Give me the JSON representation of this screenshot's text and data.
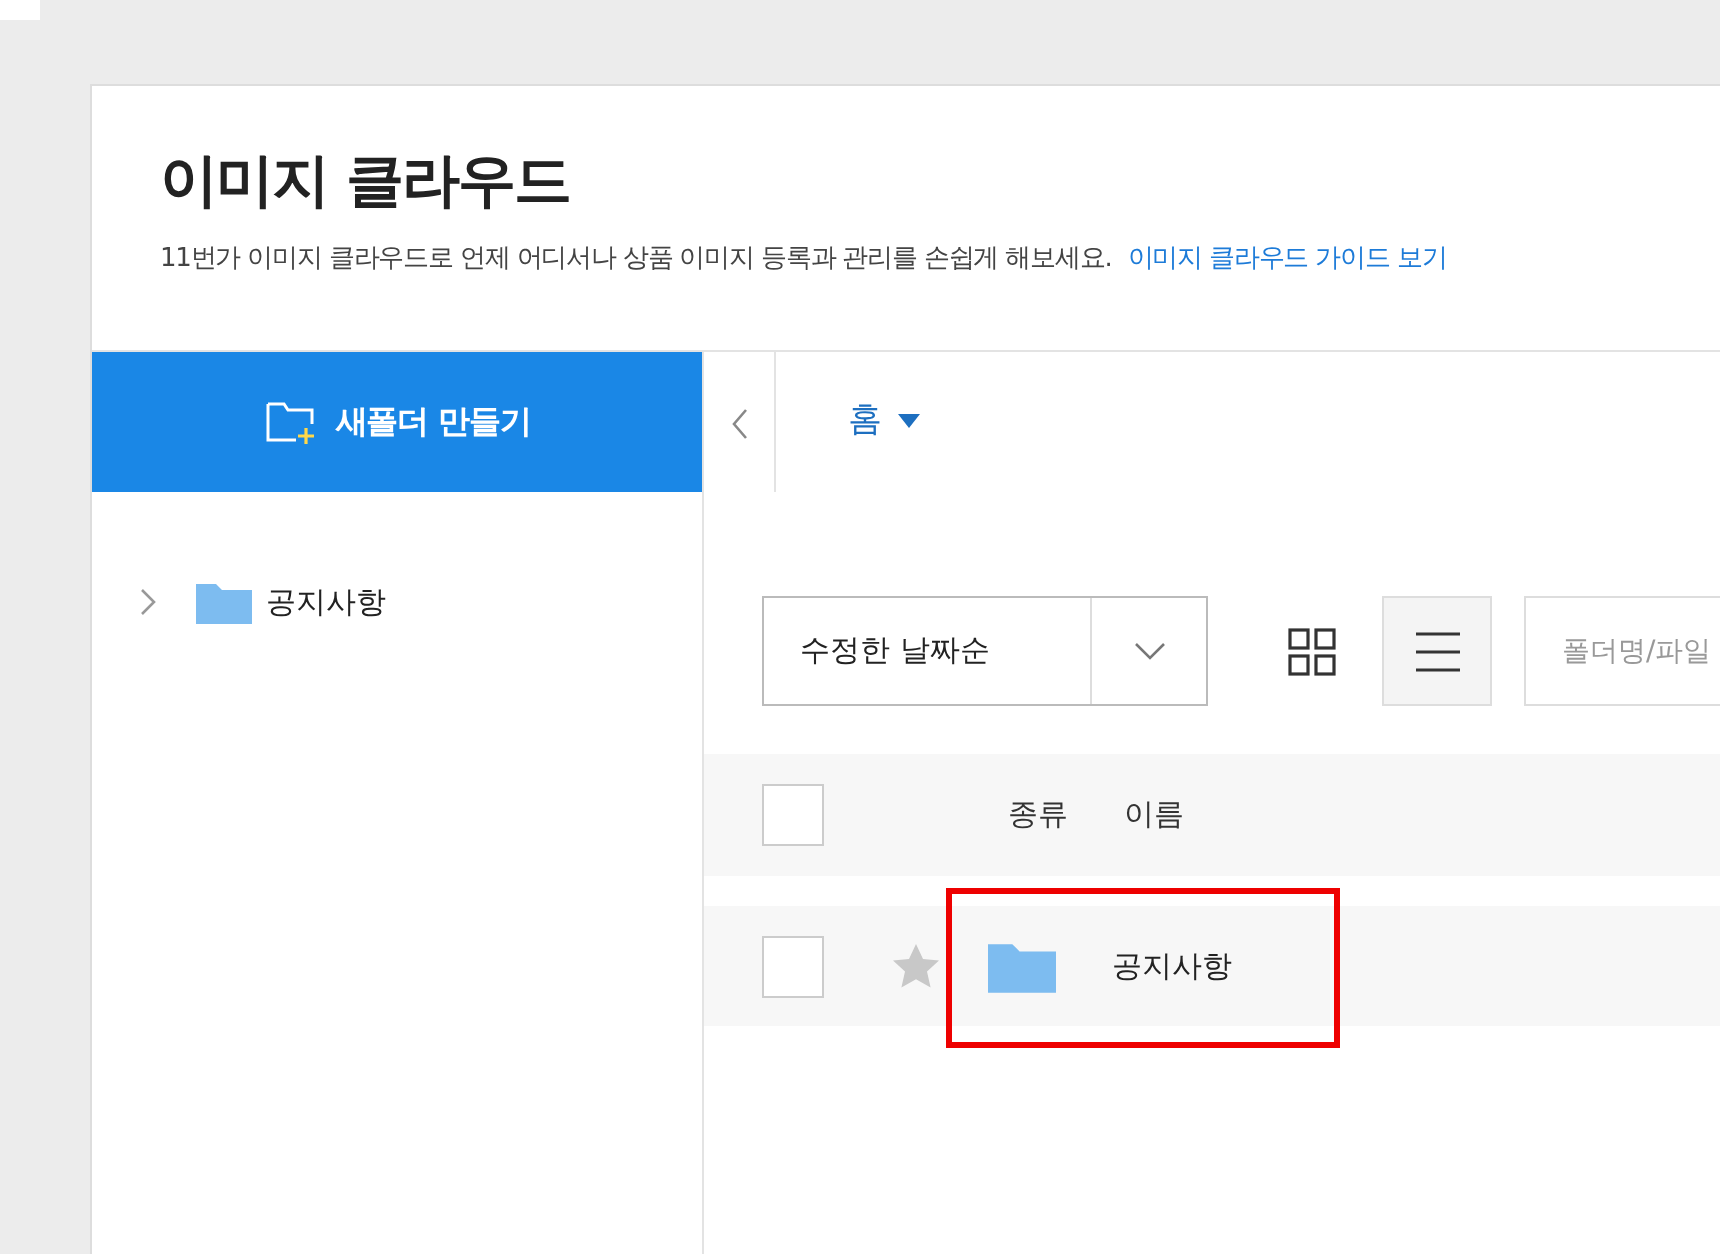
{
  "title": "이미지 클라우드",
  "description": "11번가 이미지 클라우드로 언제 어디서나 상품 이미지 등록과 관리를 손쉽게 해보세요.",
  "guide_link": "이미지 클라우드 가이드 보기",
  "new_folder_button": "새폴더 만들기",
  "breadcrumb": "홈",
  "tree": [
    {
      "label": "공지사항",
      "expanded": false
    }
  ],
  "sort_select": "수정한 날짜순",
  "view_modes": [
    {
      "kind": "grid",
      "selected": false
    },
    {
      "kind": "list",
      "selected": true
    }
  ],
  "search": {
    "placeholder": "폴더명/파일"
  },
  "table": {
    "select_all_checked": false,
    "columns": [
      "종류",
      "이름"
    ],
    "rows": [
      {
        "name": "공지사항",
        "checked": false,
        "starred": false,
        "highlighted": true
      }
    ]
  }
}
